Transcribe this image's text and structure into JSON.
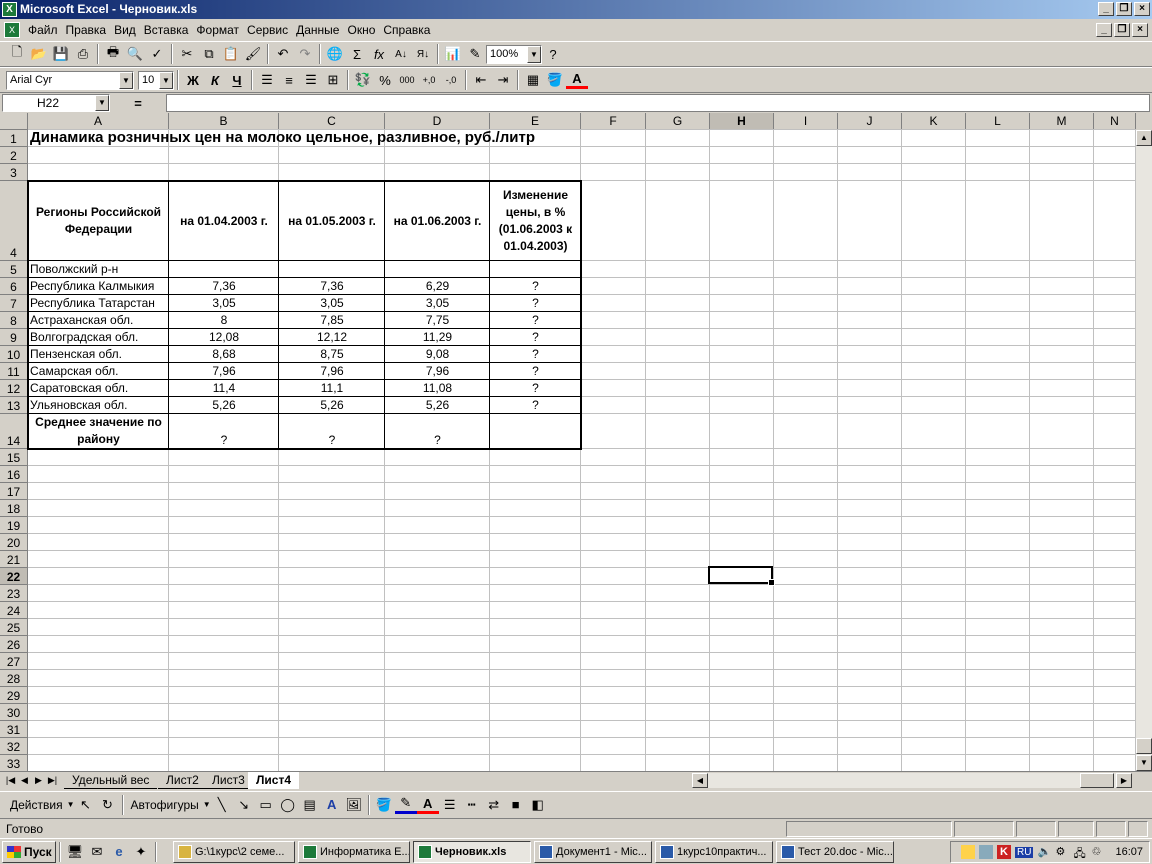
{
  "window": {
    "title": "Microsoft Excel - Черновик.xls",
    "app_icon": "excel-icon"
  },
  "menu": [
    "Файл",
    "Правка",
    "Вид",
    "Вставка",
    "Формат",
    "Сервис",
    "Данные",
    "Окно",
    "Справка"
  ],
  "toolbar": {
    "zoom": "100%",
    "font": "Arial Cyr",
    "font_size": "10",
    "bold": "Ж",
    "italic": "К",
    "underline": "Ч",
    "sigma": "Σ",
    "fx": "fx",
    "percent": "%",
    "thousands": "000"
  },
  "formula_bar": {
    "name_box": "H22",
    "equals": "=",
    "content": ""
  },
  "columns": [
    "A",
    "B",
    "C",
    "D",
    "E",
    "F",
    "G",
    "H",
    "I",
    "J",
    "K",
    "L",
    "M",
    "N"
  ],
  "rows": [
    "1",
    "2",
    "3",
    "4",
    "5",
    "6",
    "7",
    "8",
    "9",
    "10",
    "11",
    "12",
    "13",
    "14",
    "15",
    "16",
    "17",
    "18",
    "19",
    "20",
    "21",
    "22",
    "23",
    "24",
    "25",
    "26",
    "27",
    "28",
    "29",
    "30",
    "31",
    "32",
    "33"
  ],
  "sheet": {
    "title": "Динамика розничных цен на молоко цельное, разливное, руб./литр",
    "headers": {
      "region": "Регионы Российской Федерации",
      "d1": "на 01.04.2003 г.",
      "d2": "на 01.05.2003 г.",
      "d3": "на 01.06.2003 г.",
      "change": "Изменение цены, в % (01.06.2003 к 01.04.2003)"
    },
    "district": "Поволжский р-н",
    "data": [
      {
        "region": "Республика Калмыкия",
        "b": "7,36",
        "c": "7,36",
        "d": "6,29",
        "e": "?"
      },
      {
        "region": "Республика Татарстан",
        "b": "3,05",
        "c": "3,05",
        "d": "3,05",
        "e": "?"
      },
      {
        "region": "Астраханская обл.",
        "b": "8",
        "c": "7,85",
        "d": "7,75",
        "e": "?"
      },
      {
        "region": "Волгоградская обл.",
        "b": "12,08",
        "c": "12,12",
        "d": "11,29",
        "e": "?"
      },
      {
        "region": "Пензенская обл.",
        "b": "8,68",
        "c": "8,75",
        "d": "9,08",
        "e": "?"
      },
      {
        "region": "Самарская обл.",
        "b": "7,96",
        "c": "7,96",
        "d": "7,96",
        "e": "?"
      },
      {
        "region": "Саратовская обл.",
        "b": "11,4",
        "c": "11,1",
        "d": "11,08",
        "e": "?"
      },
      {
        "region": "Ульяновская обл.",
        "b": "5,26",
        "c": "5,26",
        "d": "5,26",
        "e": "?"
      }
    ],
    "avg": {
      "label": "Среднее значение по району",
      "b": "?",
      "c": "?",
      "d": "?"
    }
  },
  "sheet_tabs": [
    "Удельный вес",
    "Лист2",
    "Лист3",
    "Лист4"
  ],
  "active_tab": "Лист4",
  "drawing": {
    "actions": "Действия",
    "autoshapes": "Автофигуры"
  },
  "status": "Готово",
  "taskbar": {
    "start": "Пуск",
    "tasks": [
      "G:\\1курс\\2 семе...",
      "Информатика E...",
      "Черновик.xls",
      "Документ1 - Mic...",
      "1курс10практич...",
      "Тест 20.doc - Mic..."
    ],
    "active_task": "Черновик.xls",
    "lang": "RU",
    "clock": "16:07"
  }
}
